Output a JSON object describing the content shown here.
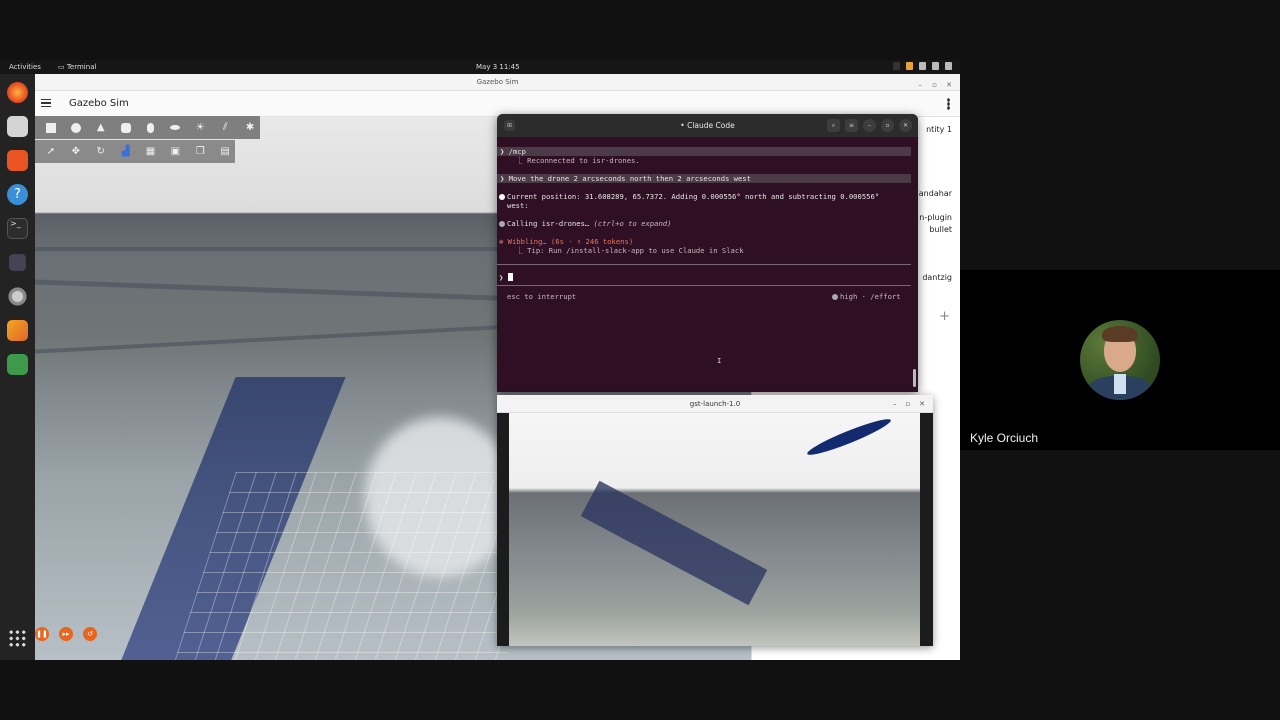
{
  "topbar": {
    "activities": "Activities",
    "app": "Terminal",
    "datetime": "May 3  11:45"
  },
  "gazebo": {
    "window_title": "Gazebo Sim",
    "header_title": "Gazebo Sim",
    "right_panel": {
      "entity": "ntity 1",
      "kandahar": "andahar",
      "plugin": "n-plugin",
      "bullet": "bullet",
      "dantzig": "dantzig"
    }
  },
  "terminal": {
    "title": "Claude Code",
    "lines": {
      "cmd": "/mcp",
      "reconnected": "  ⎿ Reconnected to isr-drones.",
      "prompt": "Move the drone 2 arcseconds north then 2 arcseconds west",
      "position": "Current position: 31.608289, 65.7372. Adding 0.000556° north and subtracting 0.000556°",
      "position2": "west:",
      "calling": "Calling isr-drones…",
      "expand_hint": " (ctrl+o to expand)",
      "wibbling": "Wibbling… (6s · ↑ 246 tokens)",
      "tip": "  ⎿ Tip: Run /install-slack-app to use Claude in Slack",
      "interrupt": "esc to interrupt",
      "effort": "high · /effort"
    }
  },
  "gst": {
    "title": "gst-launch-1.0"
  },
  "participant": {
    "name": "Kyle Orciuch"
  },
  "colors": {
    "terminal_bg": "#2f0f24",
    "accent_orange": "#e8651d"
  }
}
